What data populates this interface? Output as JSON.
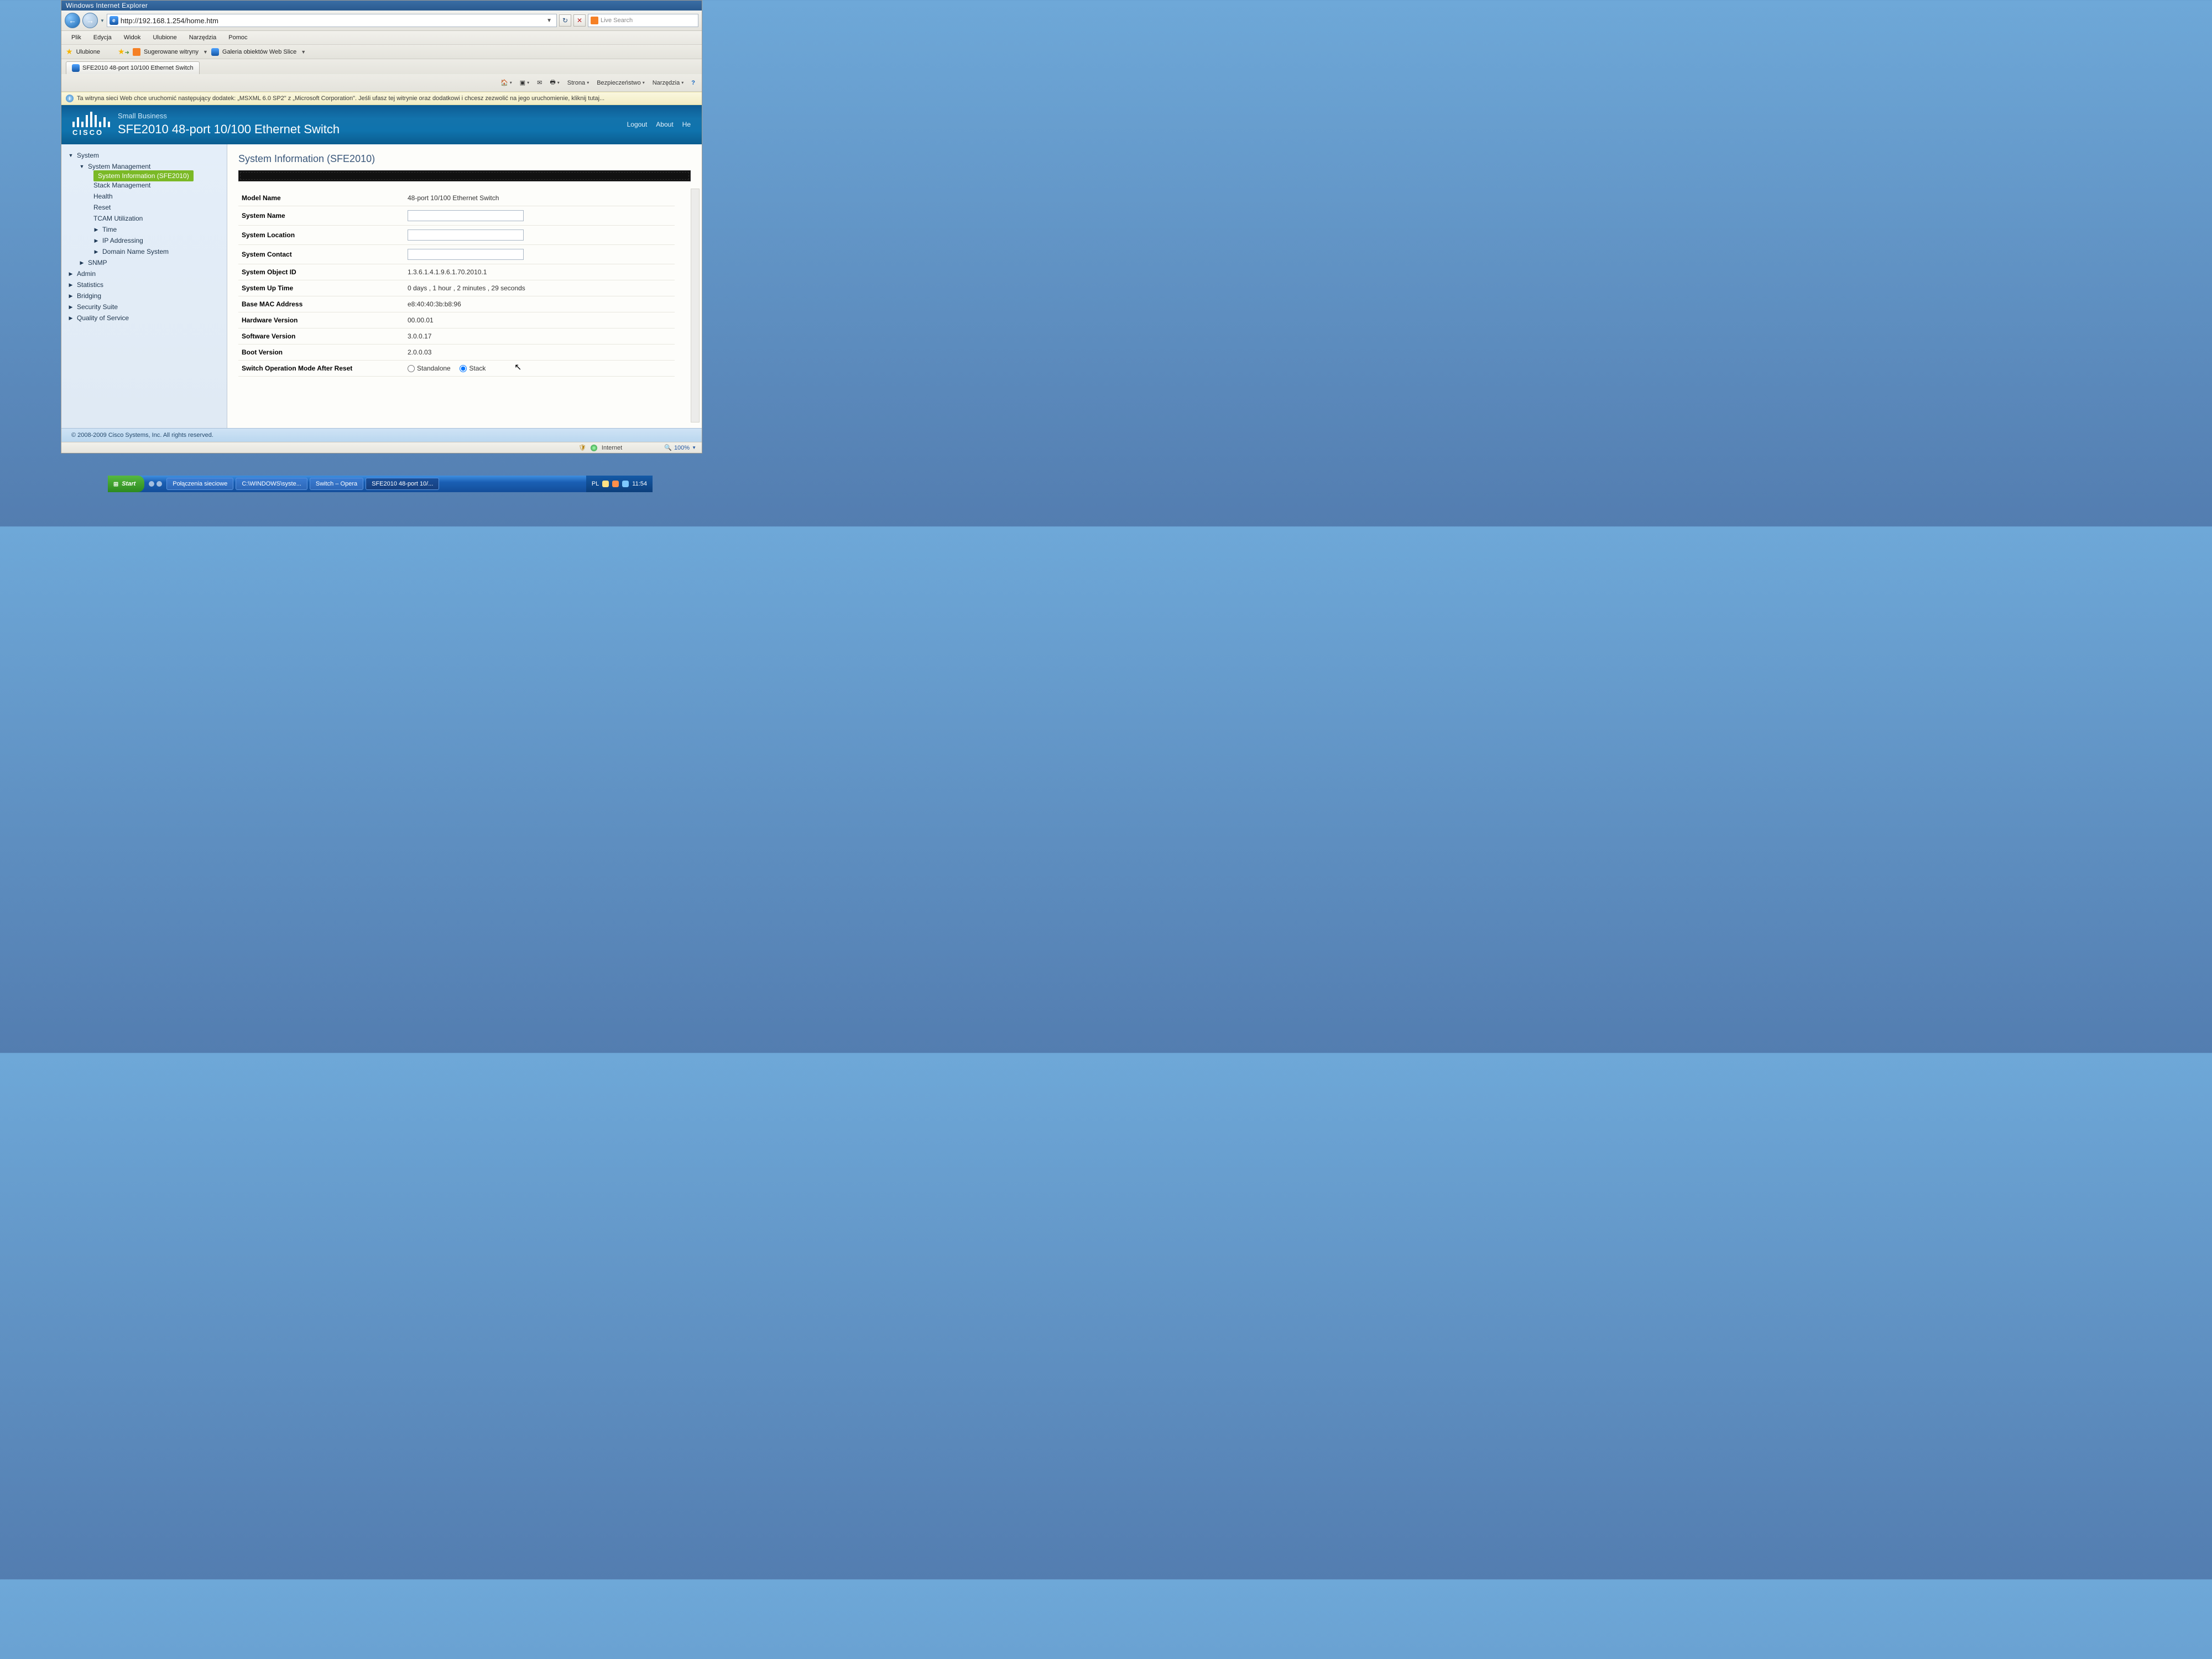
{
  "browser": {
    "title_fragment": "Windows Internet Explorer",
    "url": "http://192.168.1.254/home.htm",
    "menubar": [
      "Plik",
      "Edycja",
      "Widok",
      "Ulubione",
      "Narzędzia",
      "Pomoc"
    ],
    "favorites_label": "Ulubione",
    "suggested_sites": "Sugerowane witryny",
    "web_gallery": "Galeria obiektów Web Slice",
    "tab_title": "SFE2010 48-port 10/100 Ethernet Switch",
    "search_placeholder": "Live Search",
    "cmd": {
      "page": "Strona",
      "safety": "Bezpieczeństwo",
      "tools": "Narzędzia"
    },
    "infobar": "Ta witryna sieci Web chce uruchomić następujący dodatek: „MSXML 6.0 SP2\" z „Microsoft Corporation\". Jeśli ufasz tej witrynie oraz dodatkowi i chcesz zezwolić na jego uruchomienie, kliknij tutaj...",
    "status_zone": "Internet",
    "zoom": "100%"
  },
  "cisco": {
    "brand_small": "Small Business",
    "brand_word": "CISCO",
    "product": "SFE2010 48-port 10/100 Ethernet Switch",
    "links": {
      "logout": "Logout",
      "about": "About",
      "help": "He"
    },
    "nav": {
      "system": "System",
      "system_mgmt": "System Management",
      "sys_info": "System Information (SFE2010)",
      "stack_mgmt": "Stack Management",
      "health": "Health",
      "reset": "Reset",
      "tcam": "TCAM Utilization",
      "time": "Time",
      "ip_addr": "IP Addressing",
      "dns": "Domain Name System",
      "snmp": "SNMP",
      "admin": "Admin",
      "stats": "Statistics",
      "bridging": "Bridging",
      "security": "Security Suite",
      "qos": "Quality of Service"
    },
    "content": {
      "title": "System Information (SFE2010)",
      "rows": {
        "model_name_lbl": "Model Name",
        "model_name_val": "48-port 10/100 Ethernet Switch",
        "system_name_lbl": "System Name",
        "system_name_val": "",
        "system_loc_lbl": "System Location",
        "system_loc_val": "",
        "system_contact_lbl": "System Contact",
        "system_contact_val": "",
        "obj_id_lbl": "System Object ID",
        "obj_id_val": "1.3.6.1.4.1.9.6.1.70.2010.1",
        "uptime_lbl": "System Up Time",
        "uptime_val": "0 days , 1 hour , 2 minutes , 29 seconds",
        "mac_lbl": "Base MAC Address",
        "mac_val": "e8:40:40:3b:b8:96",
        "hw_lbl": "Hardware Version",
        "hw_val": "00.00.01",
        "sw_lbl": "Software Version",
        "sw_val": "3.0.0.17",
        "boot_lbl": "Boot Version",
        "boot_val": "2.0.0.03",
        "opmode_lbl": "Switch Operation Mode After Reset",
        "opmode_standalone": "Standalone",
        "opmode_stack": "Stack"
      }
    },
    "footer": "© 2008-2009 Cisco Systems, Inc. All rights reserved."
  },
  "taskbar": {
    "start": "Start",
    "items": [
      "Połączenia sieciowe",
      "C:\\WINDOWS\\syste...",
      "Switch – Opera",
      "SFE2010 48-port 10/..."
    ],
    "clock": "11:54",
    "lang": "PL"
  }
}
